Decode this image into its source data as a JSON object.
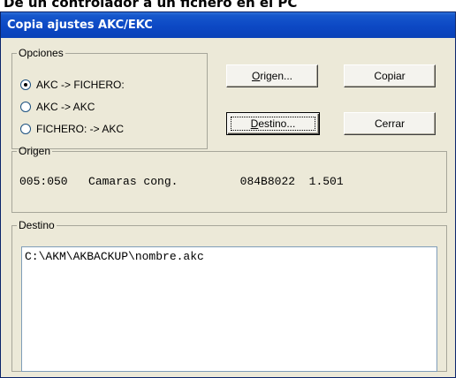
{
  "page": {
    "heading": "De un controlador a un fichero en el PC"
  },
  "window": {
    "title": "Copia ajustes AKC/EKC"
  },
  "opciones": {
    "legend": "Opciones",
    "options": [
      {
        "label": "AKC  -> FICHERO:",
        "selected": true
      },
      {
        "label": "AKC  -> AKC",
        "selected": false
      },
      {
        "label": "FICHERO: -> AKC",
        "selected": false
      }
    ]
  },
  "buttons": {
    "origen": {
      "mnemonic": "O",
      "rest": "rigen..."
    },
    "copiar": {
      "label": "Copiar"
    },
    "destino": {
      "mnemonic": "D",
      "rest": "estino..."
    },
    "cerrar": {
      "label": "Cerrar"
    }
  },
  "origen": {
    "legend": "Origen",
    "line": "005:050   Camaras cong.         084B8022  1.501"
  },
  "destino": {
    "legend": "Destino",
    "value": "C:\\AKM\\AKBACKUP\\nombre.akc"
  },
  "colors": {
    "titlebar": "#0a42b8",
    "dialog_bg": "#ece9d8",
    "group_border": "#a7a69a",
    "input_border": "#7f9db9"
  }
}
